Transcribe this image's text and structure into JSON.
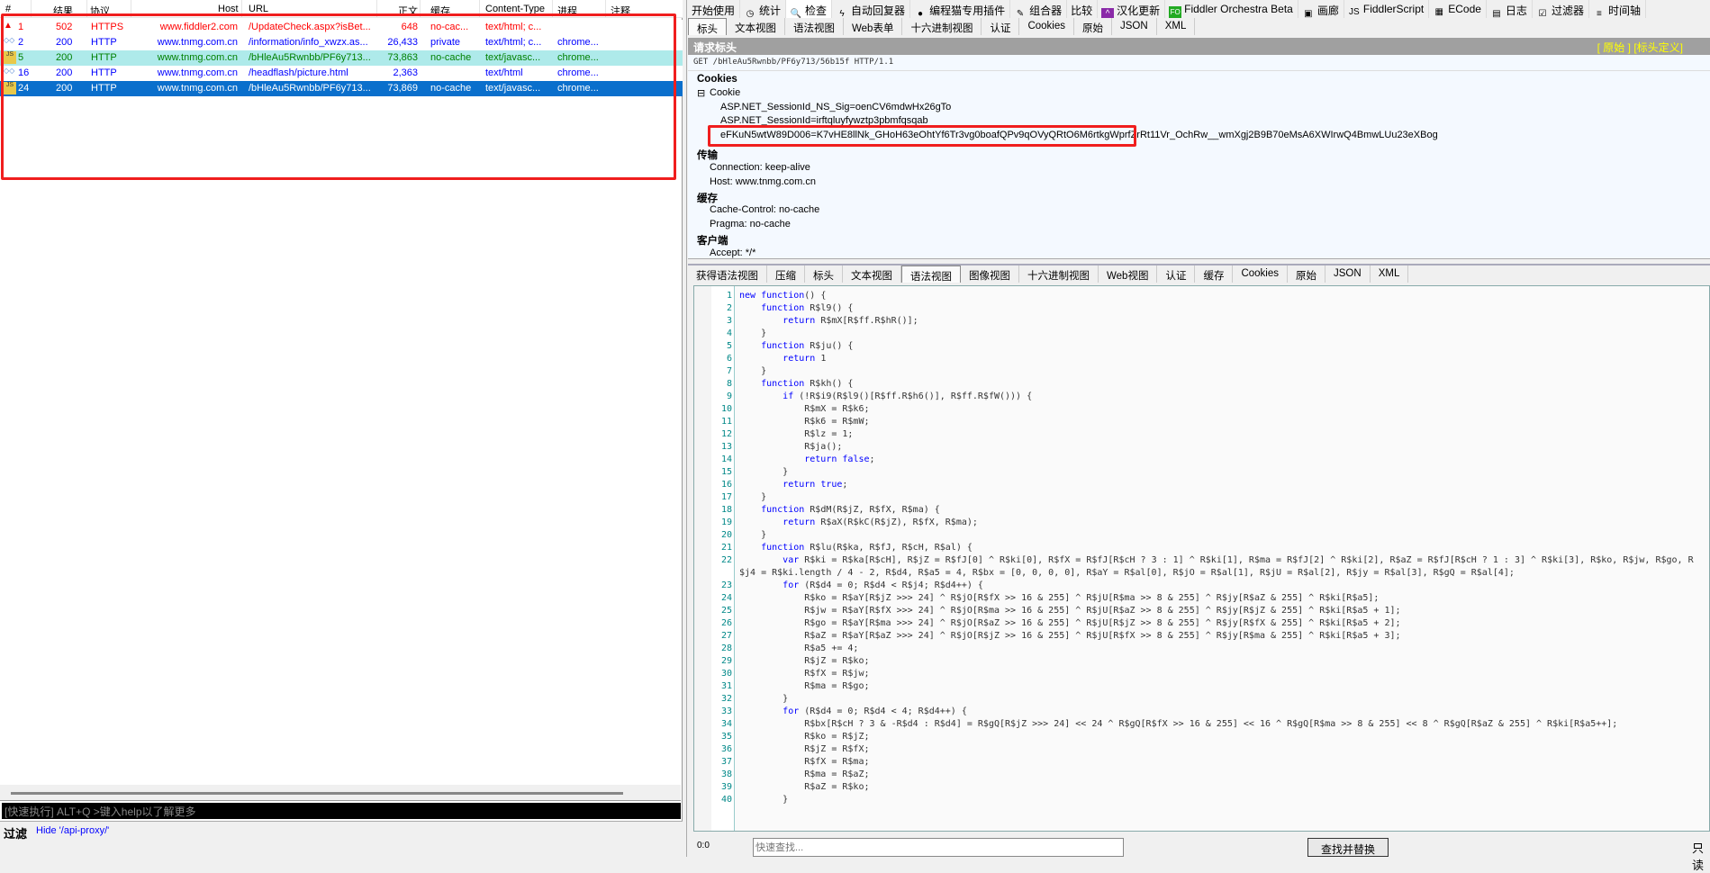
{
  "sessions": {
    "columns": [
      "#",
      "结果",
      "协议",
      "Host",
      "URL",
      "正文",
      "缓存",
      "Content-Type",
      "进程",
      "注释"
    ],
    "rows": [
      {
        "icon": "warning-icon",
        "id": "1",
        "result": "502",
        "protocol": "HTTPS",
        "host": "www.fiddler2.com",
        "url": "/UpdateCheck.aspx?isBet...",
        "body": "648",
        "caching": "no-cac...",
        "content_type": "text/html; c...",
        "process": "",
        "color": "#ff0000",
        "bg": "#ffffff"
      },
      {
        "icon": "html-icon",
        "id": "2",
        "result": "200",
        "protocol": "HTTP",
        "host": "www.tnmg.com.cn",
        "url": "/information/info_xwzx.as...",
        "body": "26,433",
        "caching": "private",
        "content_type": "text/html; c...",
        "process": "chrome...",
        "color": "#0000ff",
        "bg": "#ffffff"
      },
      {
        "icon": "script-icon",
        "id": "5",
        "result": "200",
        "protocol": "HTTP",
        "host": "www.tnmg.com.cn",
        "url": "/bHleAu5Rwnbb/PF6y713...",
        "body": "73,863",
        "caching": "no-cache",
        "content_type": "text/javasc...",
        "process": "chrome...",
        "color": "#008000",
        "bg": "#aeeaea"
      },
      {
        "icon": "html-icon",
        "id": "16",
        "result": "200",
        "protocol": "HTTP",
        "host": "www.tnmg.com.cn",
        "url": "/headflash/picture.html",
        "body": "2,363",
        "caching": "",
        "content_type": "text/html",
        "process": "chrome...",
        "color": "#0000ff",
        "bg": "#ffffff"
      },
      {
        "icon": "script-icon",
        "id": "24",
        "result": "200",
        "protocol": "HTTP",
        "host": "www.tnmg.com.cn",
        "url": "/bHleAu5Rwnbb/PF6y713...",
        "body": "73,869",
        "caching": "no-cache",
        "content_type": "text/javasc...",
        "process": "chrome...",
        "color": "#ffffff",
        "bg": "#0a6fcc",
        "selected": true
      }
    ]
  },
  "quickexec": {
    "placeholder": "[快速执行] ALT+Q >键入help以了解更多"
  },
  "filter": {
    "label": "过滤",
    "value": "Hide '/api-proxy/'"
  },
  "toolbar": [
    {
      "label": "开始使用",
      "icon": ""
    },
    {
      "label": "统计",
      "icon": "clock-icon"
    },
    {
      "label": "检查",
      "icon": "magnifier-icon"
    },
    {
      "label": "自动回复器",
      "icon": "lightning-icon"
    },
    {
      "label": "编程猫专用插件",
      "icon": "palette-icon"
    },
    {
      "label": "组合器",
      "icon": "compose-icon"
    },
    {
      "label": "比较",
      "icon": ""
    },
    {
      "label": "汉化更新",
      "icon": "update-icon"
    },
    {
      "label": "Fiddler Orchestra Beta",
      "icon": "fo-icon"
    },
    {
      "label": "画廊",
      "icon": "gallery-icon"
    },
    {
      "label": "FiddlerScript",
      "icon": "script-icon"
    },
    {
      "label": "ECode",
      "icon": "ecode-icon"
    },
    {
      "label": "日志",
      "icon": "log-icon"
    },
    {
      "label": "过滤器",
      "icon": "checkbox-icon"
    },
    {
      "label": "时间轴",
      "icon": "timeline-icon"
    }
  ],
  "request_tabs": [
    "标头",
    "文本视图",
    "语法视图",
    "Web表单",
    "十六进制视图",
    "认证",
    "Cookies",
    "原始",
    "JSON",
    "XML"
  ],
  "request_selected_tab": "标头",
  "request_headers": {
    "title": "请求标头",
    "raw_link": "[ 原始 ]",
    "defs_link": "[标头定义]",
    "request_line": "GET /bHleAu5Rwnbb/PF6y713/56b15f HTTP/1.1",
    "groups": {
      "cookies": "Cookies",
      "cookie": "Cookie",
      "cookie_items": [
        "ASP.NET_SessionId_NS_Sig=oenCV6mdwHx26gTo",
        "ASP.NET_SessionId=irftqluyfywztp3pbmfqsqab",
        "eFKuN5wtW89D006=K7vHE8llNk_GHoH63eOhtYf6Tr3vg0boafQPv9qOVyQRtO6M6rtkgWprfZrRt11Vr_OchRw__wmXgj2B9B70eMsA6XWIrwQ4BmwLUu23eXBog"
      ],
      "transport": "传输",
      "transport_items": [
        "Connection: keep-alive",
        "Host: www.tnmg.com.cn"
      ],
      "cache": "缓存",
      "cache_items": [
        "Cache-Control: no-cache",
        "Pragma: no-cache"
      ],
      "client": "客户端",
      "client_items": [
        "Accept: */*"
      ]
    }
  },
  "response_tabs": [
    "获得语法视图",
    "压缩",
    "标头",
    "文本视图",
    "语法视图",
    "图像视图",
    "十六进制视图",
    "Web视图",
    "认证",
    "缓存",
    "Cookies",
    "原始",
    "JSON",
    "XML"
  ],
  "response_selected_tab": "语法视图",
  "code": [
    "new function() {",
    "    function R$l9() {",
    "        return R$mX[R$ff.R$hR()];",
    "    }",
    "    function R$ju() {",
    "        return 1",
    "    }",
    "    function R$kh() {",
    "        if (!R$i9(R$l9()[R$ff.R$h6()], R$ff.R$fW())) {",
    "            R$mX = R$k6;",
    "            R$k6 = R$mW;",
    "            R$lz = 1;",
    "            R$ja();",
    "            return false;",
    "        }",
    "        return true;",
    "    }",
    "    function R$dM(R$jZ, R$fX, R$ma) {",
    "        return R$aX(R$kC(R$jZ), R$fX, R$ma);",
    "    }",
    "    function R$lu(R$ka, R$fJ, R$cH, R$al) {",
    "        var R$ki = R$ka[R$cH], R$jZ = R$fJ[0] ^ R$ki[0], R$fX = R$fJ[R$cH ? 3 : 1] ^ R$ki[1], R$ma = R$fJ[2] ^ R$ki[2], R$aZ = R$fJ[R$cH ? 1 : 3] ^ R$ki[3], R$ko, R$jw, R$go, R$j4 = R$ki.length / 4 - 2, R$d4, R$a5 = 4, R$bx = [0, 0, 0, 0], R$aY = R$al[0], R$jO = R$al[1], R$jU = R$al[2], R$jy = R$al[3], R$gQ = R$al[4];",
    "        for (R$d4 = 0; R$d4 < R$j4; R$d4++) {",
    "            R$ko = R$aY[R$jZ >>> 24] ^ R$jO[R$fX >> 16 & 255] ^ R$jU[R$ma >> 8 & 255] ^ R$jy[R$aZ & 255] ^ R$ki[R$a5];",
    "            R$jw = R$aY[R$fX >>> 24] ^ R$jO[R$ma >> 16 & 255] ^ R$jU[R$aZ >> 8 & 255] ^ R$jy[R$jZ & 255] ^ R$ki[R$a5 + 1];",
    "            R$go = R$aY[R$ma >>> 24] ^ R$jO[R$aZ >> 16 & 255] ^ R$jU[R$jZ >> 8 & 255] ^ R$jy[R$fX & 255] ^ R$ki[R$a5 + 2];",
    "            R$aZ = R$aY[R$aZ >>> 24] ^ R$jO[R$jZ >> 16 & 255] ^ R$jU[R$fX >> 8 & 255] ^ R$jy[R$ma & 255] ^ R$ki[R$a5 + 3];",
    "            R$a5 += 4;",
    "            R$jZ = R$ko;",
    "            R$fX = R$jw;",
    "            R$ma = R$go;",
    "        }",
    "        for (R$d4 = 0; R$d4 < 4; R$d4++) {",
    "            R$bx[R$cH ? 3 & -R$d4 : R$d4] = R$gQ[R$jZ >>> 24] << 24 ^ R$gQ[R$fX >> 16 & 255] << 16 ^ R$gQ[R$ma >> 8 & 255] << 8 ^ R$gQ[R$aZ & 255] ^ R$ki[R$a5++];",
    "            R$ko = R$jZ;",
    "            R$jZ = R$fX;",
    "            R$fX = R$ma;",
    "            R$ma = R$aZ;",
    "            R$aZ = R$ko;",
    "        }"
  ],
  "status": {
    "position": "0:0",
    "find_placeholder": "快速查找...",
    "find_replace": "查找并替换",
    "readonly": "只读"
  },
  "colors": {
    "highlight_box": "#f01e1e",
    "selected_row": "#0a6fcc",
    "header_bar": "#a0a0a0",
    "keyword": "#0000ff"
  }
}
